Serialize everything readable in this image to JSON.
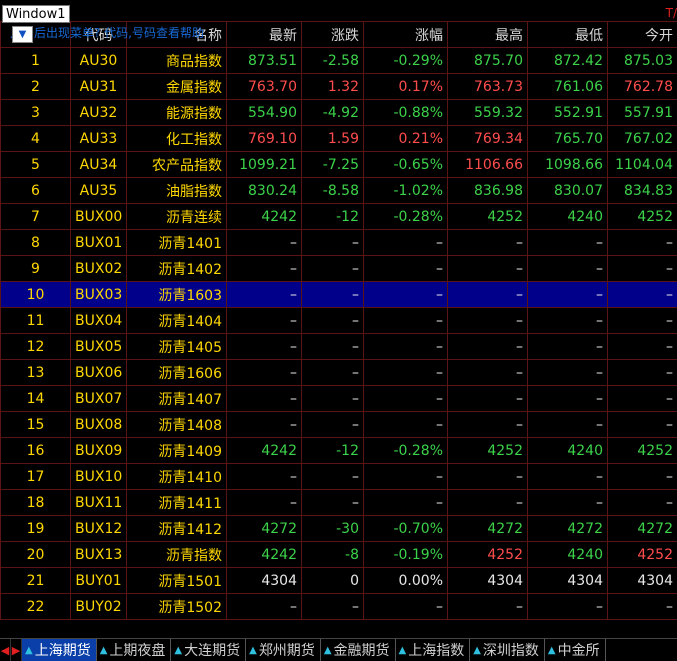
{
  "window": {
    "title": "Window1",
    "right_marker": "T/"
  },
  "hint": "点击后出现菜单? 代码,号码查看帮助",
  "columns": [
    "",
    "代码",
    "名称",
    "最新",
    "涨跌",
    "涨幅",
    "最高",
    "最低",
    "今开"
  ],
  "rows": [
    {
      "idx": "1",
      "code": "AU30",
      "name": "商品指数",
      "last": "873.51",
      "chg": "-2.58",
      "pct": "-0.29%",
      "high": "875.70",
      "low": "872.42",
      "open": "875.03",
      "c": [
        "down",
        "down",
        "down",
        "down",
        "down",
        "down"
      ]
    },
    {
      "idx": "2",
      "code": "AU31",
      "name": "金属指数",
      "last": "763.70",
      "chg": "1.32",
      "pct": "0.17%",
      "high": "763.73",
      "low": "761.06",
      "open": "762.78",
      "c": [
        "up",
        "up",
        "up",
        "up",
        "down",
        "up"
      ]
    },
    {
      "idx": "3",
      "code": "AU32",
      "name": "能源指数",
      "last": "554.90",
      "chg": "-4.92",
      "pct": "-0.88%",
      "high": "559.32",
      "low": "552.91",
      "open": "557.91",
      "c": [
        "down",
        "down",
        "down",
        "down",
        "down",
        "down"
      ]
    },
    {
      "idx": "4",
      "code": "AU33",
      "name": "化工指数",
      "last": "769.10",
      "chg": "1.59",
      "pct": "0.21%",
      "high": "769.34",
      "low": "765.70",
      "open": "767.02",
      "c": [
        "up",
        "up",
        "up",
        "up",
        "down",
        "down"
      ]
    },
    {
      "idx": "5",
      "code": "AU34",
      "name": "农产品指数",
      "last": "1099.21",
      "chg": "-7.25",
      "pct": "-0.65%",
      "high": "1106.66",
      "low": "1098.66",
      "open": "1104.04",
      "c": [
        "down",
        "down",
        "down",
        "up",
        "down",
        "down"
      ]
    },
    {
      "idx": "6",
      "code": "AU35",
      "name": "油脂指数",
      "last": "830.24",
      "chg": "-8.58",
      "pct": "-1.02%",
      "high": "836.98",
      "low": "830.07",
      "open": "834.83",
      "c": [
        "down",
        "down",
        "down",
        "down",
        "down",
        "down"
      ]
    },
    {
      "idx": "7",
      "code": "BUX00",
      "name": "沥青连续",
      "last": "4242",
      "chg": "-12",
      "pct": "-0.28%",
      "high": "4252",
      "low": "4240",
      "open": "4252",
      "c": [
        "down",
        "down",
        "down",
        "down",
        "down",
        "down"
      ]
    },
    {
      "idx": "8",
      "code": "BUX01",
      "name": "沥青1401",
      "last": "–",
      "chg": "–",
      "pct": "–",
      "high": "–",
      "low": "–",
      "open": "–",
      "c": [
        "flat",
        "flat",
        "flat",
        "flat",
        "flat",
        "flat"
      ]
    },
    {
      "idx": "9",
      "code": "BUX02",
      "name": "沥青1402",
      "last": "–",
      "chg": "–",
      "pct": "–",
      "high": "–",
      "low": "–",
      "open": "–",
      "c": [
        "flat",
        "flat",
        "flat",
        "flat",
        "flat",
        "flat"
      ]
    },
    {
      "idx": "10",
      "code": "BUX03",
      "name": "沥青1603",
      "last": "–",
      "chg": "–",
      "pct": "–",
      "high": "–",
      "low": "–",
      "open": "–",
      "c": [
        "flat",
        "flat",
        "flat",
        "flat",
        "flat",
        "flat"
      ],
      "selected": true
    },
    {
      "idx": "11",
      "code": "BUX04",
      "name": "沥青1404",
      "last": "–",
      "chg": "–",
      "pct": "–",
      "high": "–",
      "low": "–",
      "open": "–",
      "c": [
        "flat",
        "flat",
        "flat",
        "flat",
        "flat",
        "flat"
      ]
    },
    {
      "idx": "12",
      "code": "BUX05",
      "name": "沥青1405",
      "last": "–",
      "chg": "–",
      "pct": "–",
      "high": "–",
      "low": "–",
      "open": "–",
      "c": [
        "flat",
        "flat",
        "flat",
        "flat",
        "flat",
        "flat"
      ]
    },
    {
      "idx": "13",
      "code": "BUX06",
      "name": "沥青1606",
      "last": "–",
      "chg": "–",
      "pct": "–",
      "high": "–",
      "low": "–",
      "open": "–",
      "c": [
        "flat",
        "flat",
        "flat",
        "flat",
        "flat",
        "flat"
      ]
    },
    {
      "idx": "14",
      "code": "BUX07",
      "name": "沥青1407",
      "last": "–",
      "chg": "–",
      "pct": "–",
      "high": "–",
      "low": "–",
      "open": "–",
      "c": [
        "flat",
        "flat",
        "flat",
        "flat",
        "flat",
        "flat"
      ]
    },
    {
      "idx": "15",
      "code": "BUX08",
      "name": "沥青1408",
      "last": "–",
      "chg": "–",
      "pct": "–",
      "high": "–",
      "low": "–",
      "open": "–",
      "c": [
        "flat",
        "flat",
        "flat",
        "flat",
        "flat",
        "flat"
      ]
    },
    {
      "idx": "16",
      "code": "BUX09",
      "name": "沥青1409",
      "last": "4242",
      "chg": "-12",
      "pct": "-0.28%",
      "high": "4252",
      "low": "4240",
      "open": "4252",
      "c": [
        "down",
        "down",
        "down",
        "down",
        "down",
        "down"
      ]
    },
    {
      "idx": "17",
      "code": "BUX10",
      "name": "沥青1410",
      "last": "–",
      "chg": "–",
      "pct": "–",
      "high": "–",
      "low": "–",
      "open": "–",
      "c": [
        "flat",
        "flat",
        "flat",
        "flat",
        "flat",
        "flat"
      ]
    },
    {
      "idx": "18",
      "code": "BUX11",
      "name": "沥青1411",
      "last": "–",
      "chg": "–",
      "pct": "–",
      "high": "–",
      "low": "–",
      "open": "–",
      "c": [
        "flat",
        "flat",
        "flat",
        "flat",
        "flat",
        "flat"
      ]
    },
    {
      "idx": "19",
      "code": "BUX12",
      "name": "沥青1412",
      "last": "4272",
      "chg": "-30",
      "pct": "-0.70%",
      "high": "4272",
      "low": "4272",
      "open": "4272",
      "c": [
        "down",
        "down",
        "down",
        "down",
        "down",
        "down"
      ]
    },
    {
      "idx": "20",
      "code": "BUX13",
      "name": "沥青指数",
      "last": "4242",
      "chg": "-8",
      "pct": "-0.19%",
      "high": "4252",
      "low": "4240",
      "open": "4252",
      "c": [
        "down",
        "down",
        "down",
        "up",
        "down",
        "up"
      ]
    },
    {
      "idx": "21",
      "code": "BUY01",
      "name": "沥青1501",
      "last": "4304",
      "chg": "0",
      "pct": "0.00%",
      "high": "4304",
      "low": "4304",
      "open": "4304",
      "c": [
        "flat",
        "flat",
        "flat",
        "flat",
        "flat",
        "flat"
      ]
    },
    {
      "idx": "22",
      "code": "BUY02",
      "name": "沥青1502",
      "last": "–",
      "chg": "–",
      "pct": "–",
      "high": "–",
      "low": "–",
      "open": "–",
      "c": [
        "flat",
        "flat",
        "flat",
        "flat",
        "flat",
        "flat"
      ]
    }
  ],
  "tabs": [
    {
      "label": "上海期货",
      "active": true
    },
    {
      "label": "上期夜盘"
    },
    {
      "label": "大连期货"
    },
    {
      "label": "郑州期货"
    },
    {
      "label": "金融期货"
    },
    {
      "label": "上海指数"
    },
    {
      "label": "深圳指数"
    },
    {
      "label": "中金所"
    }
  ],
  "colors": {
    "up": "#ff4d4d",
    "down": "#3cd24a",
    "flat": "#e8e8e8",
    "label": "#ffd800",
    "selected": "#00008b",
    "grid": "#5a1414"
  },
  "icons": {
    "menu": "menu-dropdown-icon",
    "tab": "triangle-up-icon",
    "nav_left": "arrow-left-icon",
    "nav_right": "arrow-right-icon"
  }
}
